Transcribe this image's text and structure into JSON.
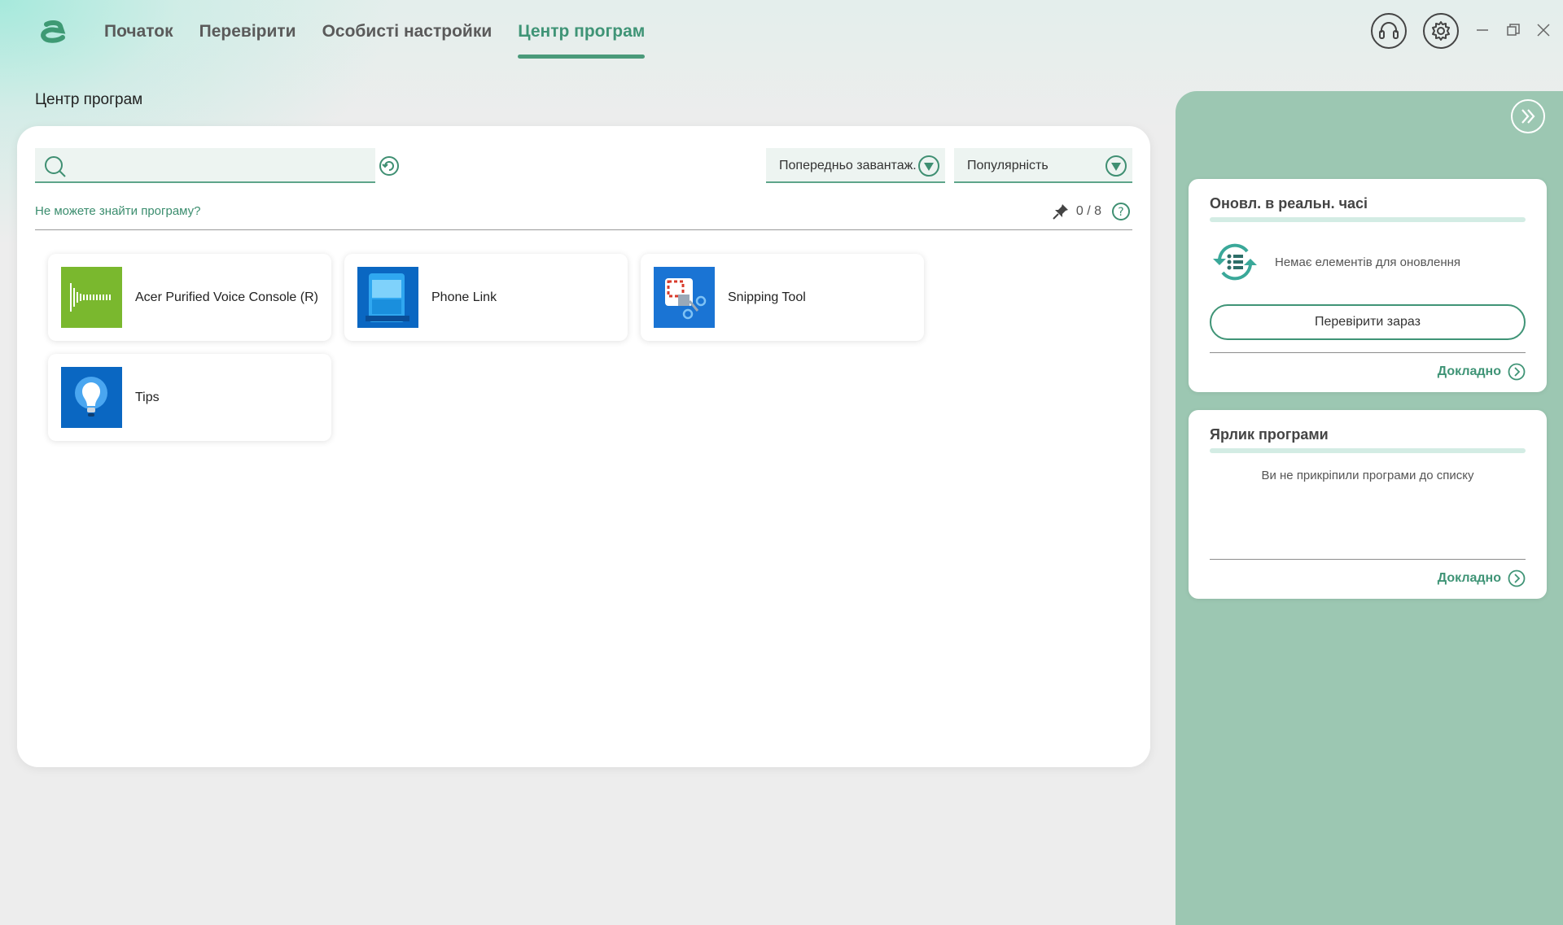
{
  "nav": {
    "items": [
      {
        "label": "Початок"
      },
      {
        "label": "Перевірити"
      },
      {
        "label": "Особисті настройки"
      },
      {
        "label": "Центр програм"
      }
    ],
    "active_index": 3
  },
  "page_title": "Центр програм",
  "search": {
    "value": "",
    "placeholder": ""
  },
  "filters": {
    "preinstalled_label": "Попередньо завантаж.",
    "sort_label": "Популярність"
  },
  "help_link": "Не можете знайти програму?",
  "pin_counter": "0 / 8",
  "apps": [
    {
      "name": "Acer Purified Voice Console (R)",
      "icon": "acer-purified-voice-icon"
    },
    {
      "name": "Phone Link",
      "icon": "phone-link-icon"
    },
    {
      "name": "Snipping Tool",
      "icon": "snipping-tool-icon"
    },
    {
      "name": "Tips",
      "icon": "tips-icon"
    }
  ],
  "side_panel": {
    "updates": {
      "title": "Онoвл. в реальн. часі",
      "status": "Немає елементів для оновлення",
      "check_button": "Перевірити зараз",
      "more_link": "Докладно"
    },
    "shortcuts": {
      "title": "Ярлик програми",
      "empty_text": "Ви не прикріпили програми до списку",
      "more_link": "Докладно"
    }
  },
  "colors": {
    "accent": "#3f9476",
    "panel_bg": "#9cc7b2",
    "field_bg": "#edf4f1"
  }
}
